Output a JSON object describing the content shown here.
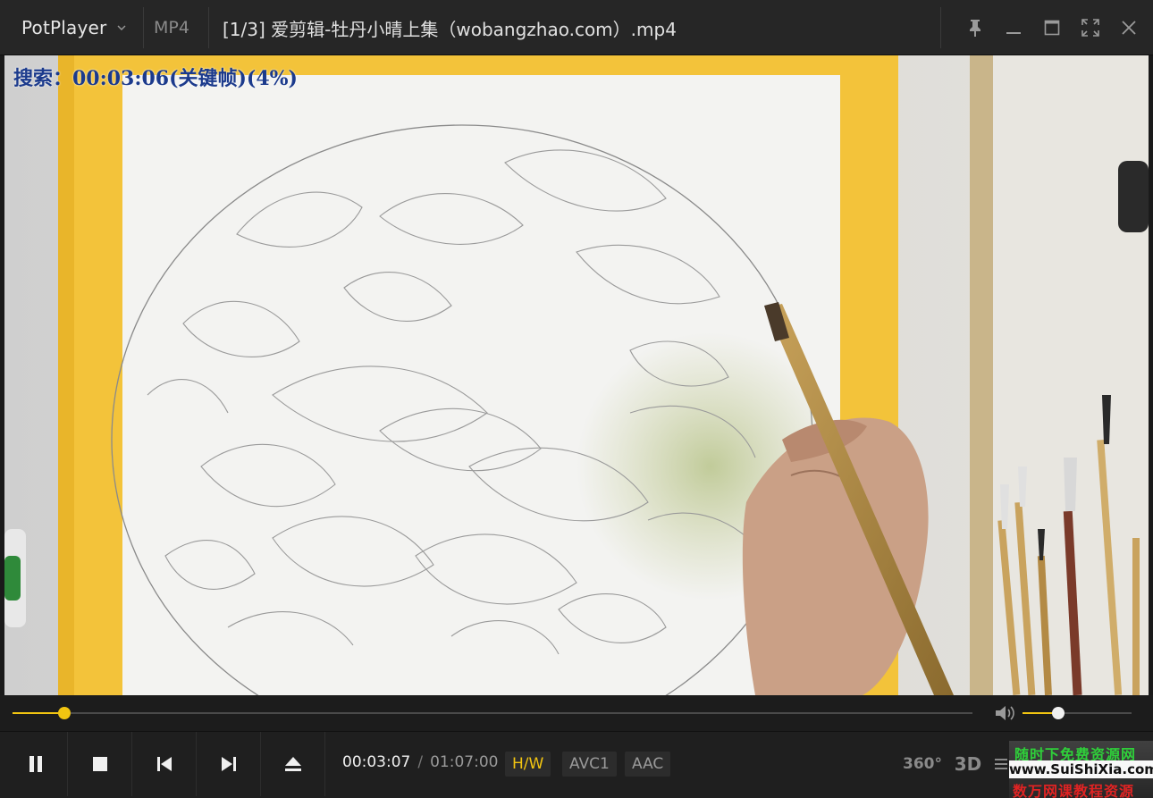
{
  "app": {
    "brand": "PotPlayer",
    "format": "MP4",
    "file_title": "[1/3] 爱剪辑-牡丹小晴上集（wobangzhao.com）.mp4"
  },
  "video": {
    "osd_text": "搜索：00:03:06(关键帧)(4%)"
  },
  "playback": {
    "current_time": "00:03:07",
    "separator": "/",
    "total_time": "01:07:00",
    "progress_fraction": 0.054,
    "volume_fraction": 0.33
  },
  "badges": {
    "hw": "H/W",
    "video_codec": "AVC1",
    "audio_codec": "AAC"
  },
  "right_controls": {
    "vr360": "360°",
    "stereo3d": "3D"
  },
  "watermark": {
    "line1": "随时下免费资源网",
    "line2": "www.SuiShiXia.com",
    "line3": "数万网课教程资源"
  },
  "colors": {
    "accent": "#f2c511",
    "background": "#1f1f1f"
  },
  "icons": {
    "brand_menu": "chevron-down-icon",
    "pin": "pin-icon",
    "minimize": "minimize-icon",
    "maximize": "maximize-icon",
    "fullscreen": "fullscreen-icon",
    "close": "close-icon",
    "pause": "pause-icon",
    "stop": "stop-icon",
    "prev": "skip-previous-icon",
    "next": "skip-next-icon",
    "eject": "eject-icon",
    "volume": "speaker-icon"
  }
}
